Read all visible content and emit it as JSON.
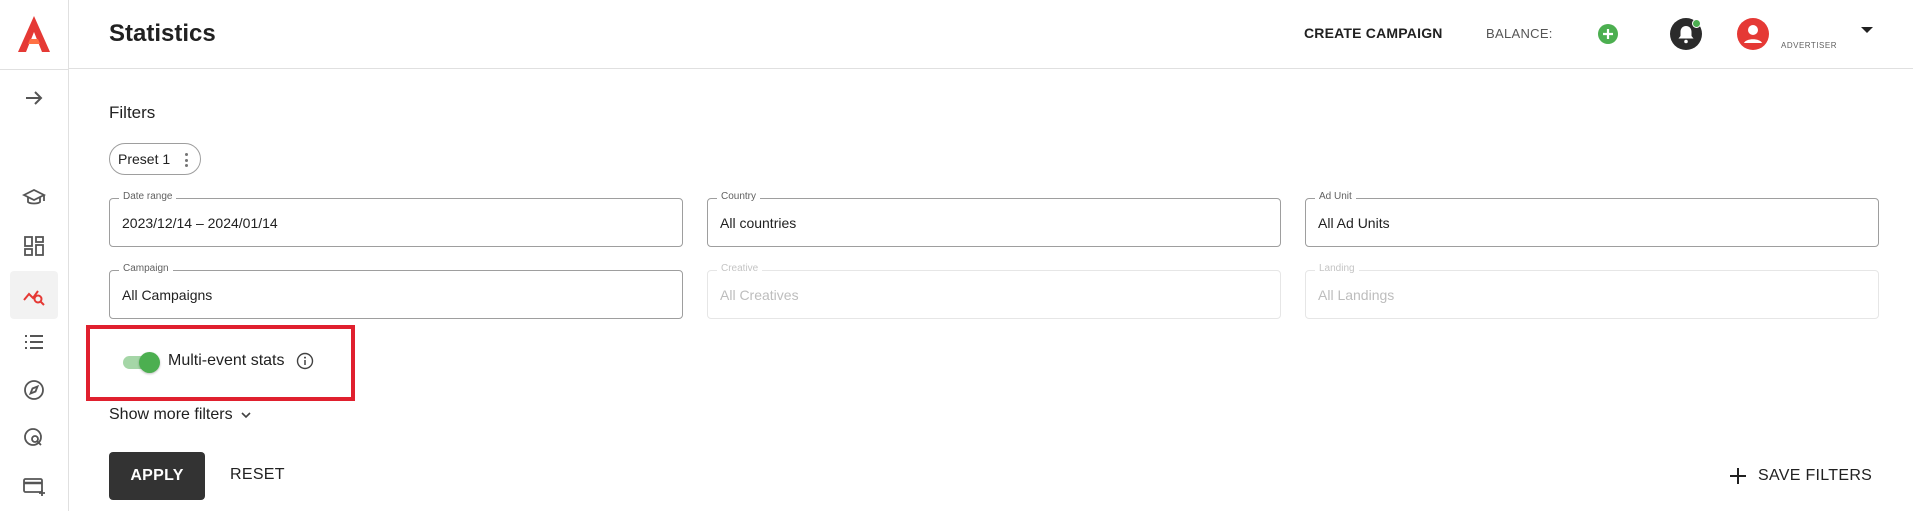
{
  "header": {
    "title": "Statistics",
    "create_campaign_label": "CREATE CAMPAIGN",
    "balance_label": "BALANCE:",
    "role_label": "ADVERTISER"
  },
  "sidebar": {
    "items": [
      {
        "icon": "arrow-right-icon"
      },
      {
        "icon": "graduation-cap-icon"
      },
      {
        "icon": "dashboard-icon"
      },
      {
        "icon": "statistics-icon",
        "active": true
      },
      {
        "icon": "list-icon"
      },
      {
        "icon": "compass-icon"
      },
      {
        "icon": "search-globe-icon"
      },
      {
        "icon": "add-card-icon"
      }
    ]
  },
  "filters": {
    "title": "Filters",
    "preset_label": "Preset 1",
    "fields": {
      "date_range": {
        "label": "Date range",
        "value": "2023/12/14 – 2024/01/14"
      },
      "country": {
        "label": "Country",
        "value": "All countries"
      },
      "ad_unit": {
        "label": "Ad Unit",
        "value": "All Ad Units"
      },
      "campaign": {
        "label": "Campaign",
        "value": "All Campaigns"
      },
      "creative": {
        "label": "Creative",
        "value": "All Creatives",
        "disabled": true
      },
      "landing": {
        "label": "Landing",
        "value": "All Landings",
        "disabled": true
      }
    },
    "multi_event": {
      "label": "Multi-event stats",
      "enabled": true
    },
    "show_more_label": "Show more filters",
    "apply_label": "APPLY",
    "reset_label": "RESET",
    "save_filters_label": "SAVE FILTERS"
  },
  "colors": {
    "brand": "#e53935",
    "accent_green": "#4caf50",
    "primary_button": "#333333",
    "highlight": "#e0202e"
  }
}
